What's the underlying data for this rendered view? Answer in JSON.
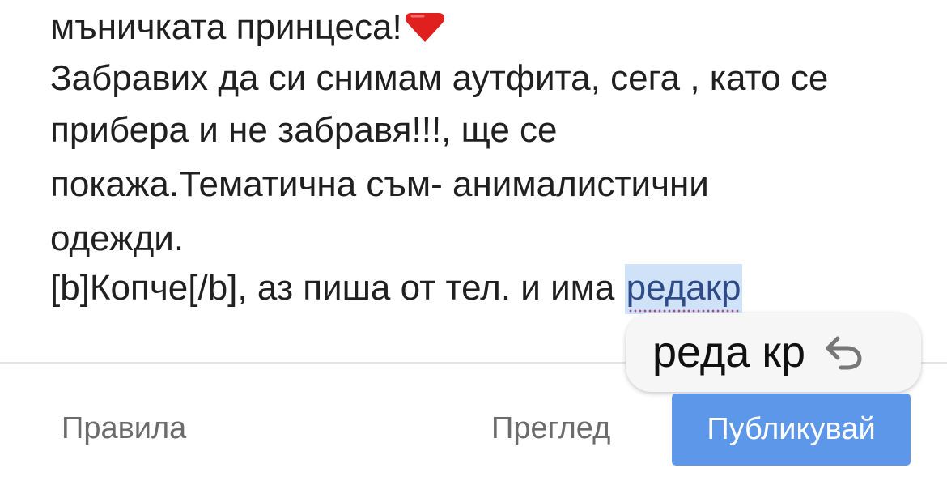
{
  "editor": {
    "line1": "мъничката принцеса!",
    "line1_emoji": "heart-emoji",
    "line2": "Забравих да си снимам аутфита, сега , като се",
    "line3": "прибера и не забравя!!!, ще се",
    "line4": "покажа.Тематична съм- анималистични",
    "line5": "одежди.",
    "line6_prefix": "[b]Копче[/b], аз пиша от тел. и има ",
    "line6_selected": "редакр"
  },
  "autocorrect": {
    "suggestion": "реда кр",
    "icon": "undo-icon"
  },
  "footer": {
    "rules_label": "Правила",
    "preview_label": "Преглед",
    "publish_label": "Публикувай"
  },
  "colors": {
    "accent": "#5d97ea",
    "selection": "#cfe2f7",
    "text": "#202020",
    "muted": "#6b6b6b",
    "heart": "#e0201e"
  }
}
